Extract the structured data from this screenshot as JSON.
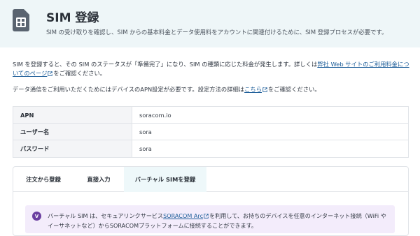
{
  "header": {
    "title": "SIM 登録",
    "subtitle": "SIM の受け取りを確認し、SIM からの基本料金とデータ使用料をアカウントに関連付けるために、SIM 登録プロセスが必要です。",
    "icon": "sim-card-icon"
  },
  "intro": {
    "p1_before": "SIM を登録すると、その SIM のステータスが「準備完了」になり、SIM の種類に応じた料金が発生します。詳しくは",
    "p1_link": "弊社 Web サイトのご利用料金についてのページ",
    "p1_after": "をご確認ください。",
    "p2_before": "データ通信をご利用いただくためにはデバイスのAPN設定が必要です。設定方法の詳細は",
    "p2_link": "こちら",
    "p2_after": "をご確認ください。"
  },
  "credentials": [
    {
      "key": "APN",
      "value": "soracom.io"
    },
    {
      "key": "ユーザー名",
      "value": "sora"
    },
    {
      "key": "パスワード",
      "value": "sora"
    }
  ],
  "tabs": [
    {
      "label": "注文から登録",
      "active": false
    },
    {
      "label": "直接入力",
      "active": false
    },
    {
      "label": "バーチャル SIMを登録",
      "active": true
    }
  ],
  "notice": {
    "icon_letter": "V",
    "text_before": "バーチャル SIM は、セキュアリンクサービス",
    "link": "SORACOM Arc",
    "text_after": "を利用して、お持ちのデバイスを任意のインターネット接続（WiFi やイーサネットなど）からSORACOMプラットフォームに接続することができます。"
  },
  "colors": {
    "header_bg": "#eef6f8",
    "link": "#1f5f9a",
    "active_tab_bg": "#eef8fa",
    "notice_bg": "#f3ecfb",
    "notice_icon": "#6b3fa0"
  }
}
